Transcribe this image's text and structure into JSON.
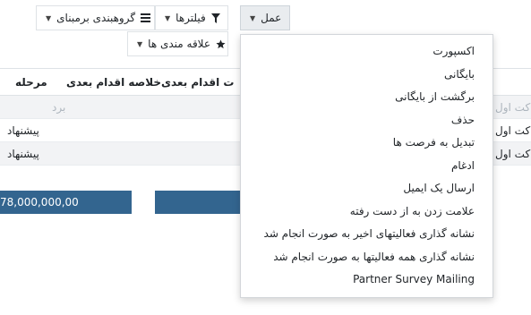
{
  "toolbar": {
    "action_label": "عمل",
    "filters_label": "فیلترها",
    "groupby_label": "گروهبندی برمبنای",
    "favorites_label": "علاقه مندی ها"
  },
  "table": {
    "headers": {
      "stage": "مرحله",
      "next_activity_summary": "خلاصه اقدام بعدی",
      "next_activity": "ت اقدام بعدی"
    },
    "rows": [
      {
        "stage": "برد",
        "left_text": "کت اول",
        "style": "muted"
      },
      {
        "stage": "پیشنهاد",
        "left_text": "کت اول",
        "style": "normal"
      },
      {
        "stage": "پیشنهاد",
        "left_text": "کت اول",
        "style": "normal"
      }
    ],
    "footer_total": "78,000,000,00"
  },
  "action_menu": {
    "items": [
      "اکسپورت",
      "بایگانی",
      "برگشت از بایگانی",
      "حذف",
      "تبدیل به فرصت ها",
      "ادغام",
      "ارسال یک ایمیل",
      "علامت زدن به از دست رفته",
      "نشانه گذاری فعالیتهای اخیر به صورت انجام شد",
      "نشانه گذاری همه فعالیتها به صورت انجام شد",
      "Partner Survey Mailing"
    ]
  },
  "icons": {
    "filter": "filter-icon",
    "groupby": "list-bars-icon",
    "favorites": "star-icon",
    "caret": "caret-down-icon"
  },
  "colors": {
    "total_bar": "#33658f",
    "row_shade": "#f2f3f5",
    "active_button": "#e9ecef"
  }
}
